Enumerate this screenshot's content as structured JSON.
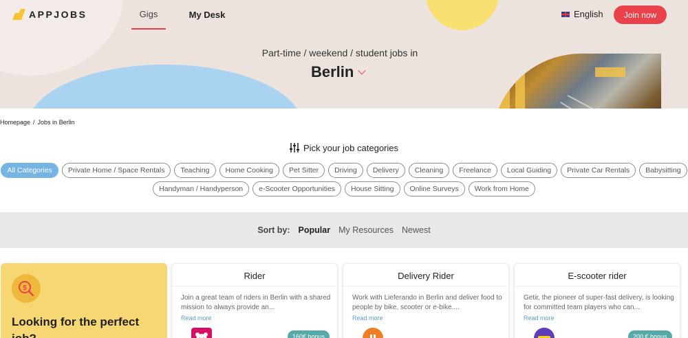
{
  "header": {
    "logo_text": "APPJOBS",
    "nav": [
      {
        "label": "Gigs",
        "active": true
      },
      {
        "label": "My Desk",
        "active": false
      }
    ],
    "language": "English",
    "join_label": "Join now",
    "accent_color": "#e9424a"
  },
  "hero": {
    "subtitle": "Part-time / weekend / student jobs in",
    "city": "Berlin"
  },
  "breadcrumb": {
    "home": "Homepage",
    "separator": "/",
    "current": "Jobs in Berlin"
  },
  "categories": {
    "title": "Pick your job categories",
    "row1": [
      "All Categories",
      "Private Home / Space Rentals",
      "Teaching",
      "Home Cooking",
      "Pet Sitter",
      "Driving",
      "Delivery",
      "Cleaning",
      "Freelance",
      "Local Guiding",
      "Private Car Rentals",
      "Babysitting"
    ],
    "row2": [
      "Handyman / Handyperson",
      "e-Scooter Opportunities",
      "House Sitting",
      "Online Surveys",
      "Work from Home"
    ],
    "active": "All Categories"
  },
  "sort": {
    "label": "Sort by:",
    "options": [
      "Popular",
      "My Resources",
      "Newest"
    ],
    "active": "Popular"
  },
  "promo": {
    "text": "Looking for the perfect job?"
  },
  "jobs": [
    {
      "title": "Rider",
      "description": "Join a great team of riders in Berlin with a shared mission to always provide an...",
      "read_more": "Read more",
      "badge": "160€ bonus",
      "logo": "foodpanda-logo"
    },
    {
      "title": "Delivery Rider",
      "description": "Work with Lieferando in Berlin and deliver food to people by bike, scooter or e-bike....",
      "read_more": "Read more",
      "badge": "",
      "logo": "lieferando-logo"
    },
    {
      "title": "E-scooter rider",
      "description": "Getir, the pioneer of super-fast delivery, is looking for committed team players who can...",
      "read_more": "Read more",
      "badge": "200 € bonus",
      "logo": "getir-logo"
    }
  ]
}
